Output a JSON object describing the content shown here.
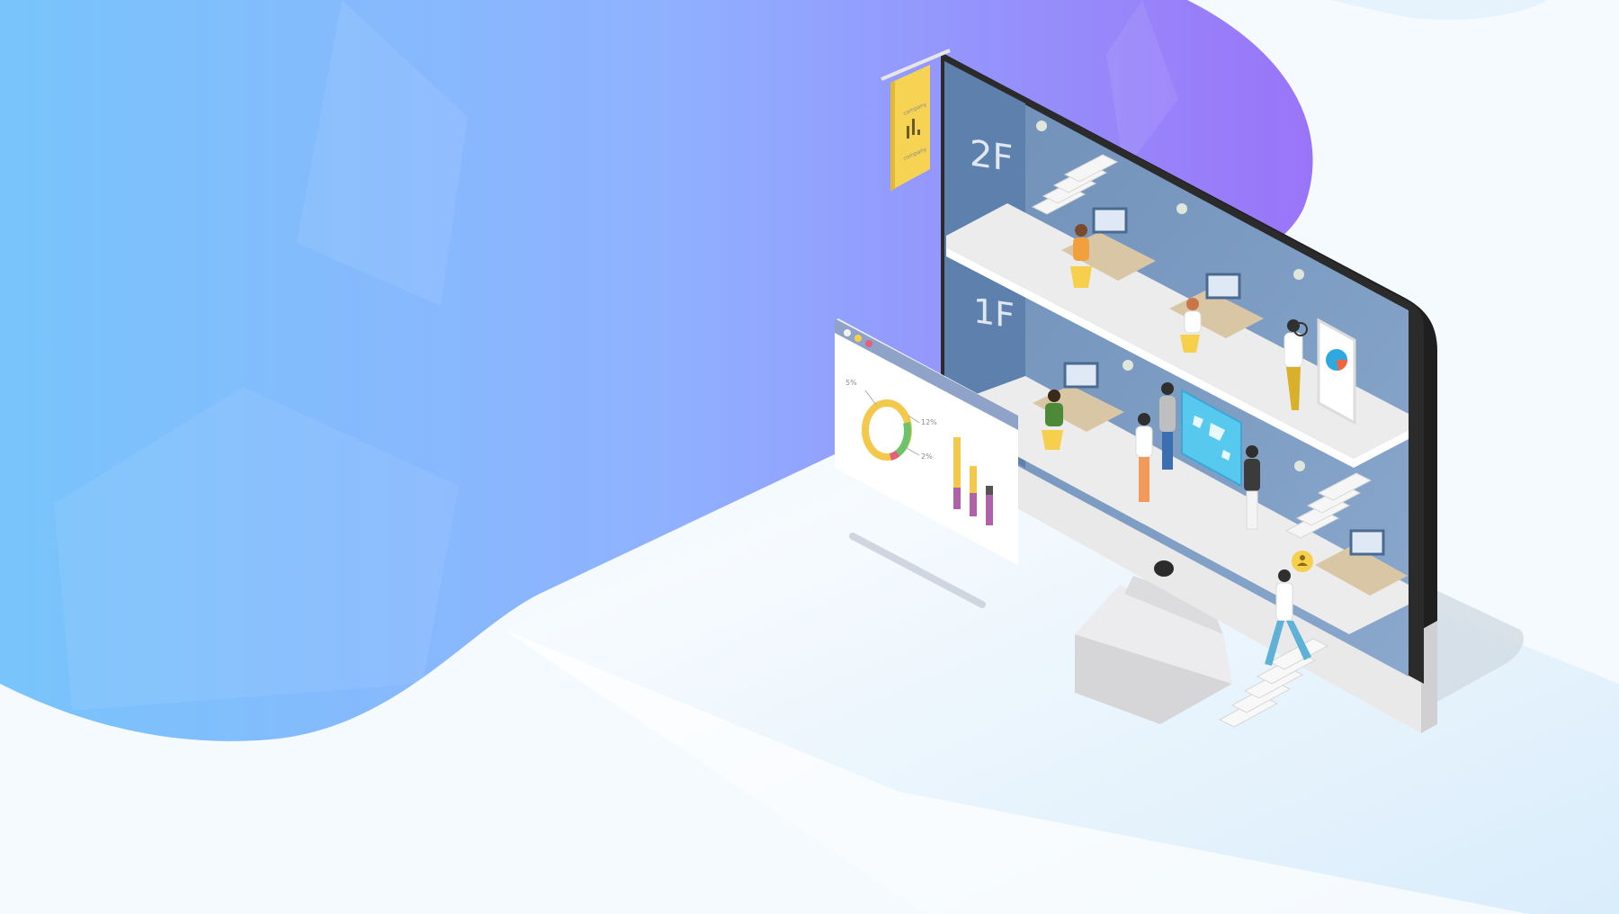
{
  "colors": {
    "blob_start": "#78c4fb",
    "blob_mid": "#8fb2ff",
    "blob_end": "#9a74f8",
    "floor_light": "#e3f2fd",
    "monitor_frame": "#2b2b2b",
    "monitor_stand": "#e9e9ea",
    "wall": "#7f9dc2",
    "wall_dark": "#5f83b0",
    "shelf": "#ececec",
    "sign": "#f7d354",
    "desk": "#d9c6a5",
    "chart_yellow": "#f2c94c",
    "chart_purple": "#b062a8",
    "chart_green": "#6bc46b",
    "chart_dark": "#555555"
  },
  "scene": {
    "floor_upper": "2F",
    "floor_lower": "1F",
    "sign_text_top": "company",
    "sign_text_bottom": "company"
  },
  "dashboard": {
    "donut_labels": [
      "5%",
      "12%",
      "2%"
    ]
  },
  "icons": [
    "lamp-icon",
    "magnifier-icon",
    "user-bubble-icon",
    "world-map-icon",
    "phone-pie-icon"
  ]
}
